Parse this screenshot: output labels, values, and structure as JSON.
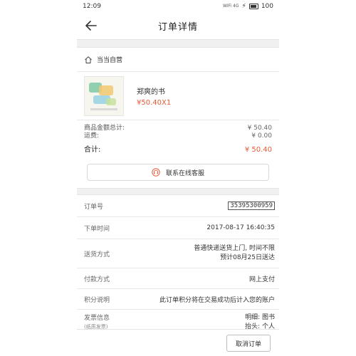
{
  "status": {
    "time": "12:09",
    "net": "WiFi 4G",
    "battery": "100"
  },
  "header": {
    "title": "订单详情"
  },
  "store": {
    "name": "当当自营"
  },
  "product": {
    "title": "郑爽的书",
    "price": "¥50.40X1"
  },
  "summary": {
    "goods_label": "商品金额总计:",
    "goods_value": "¥ 50.40",
    "shipping_label": "运费:",
    "shipping_value": "¥ 0.00",
    "total_label": "合计:",
    "total_value": "¥ 50.40"
  },
  "service": {
    "label": "联系在线客服"
  },
  "details": {
    "order_no_label": "订单号",
    "order_no": "35395300959",
    "order_time_label": "下单时间",
    "order_time": "2017-08-17 16:40:35",
    "delivery_label": "送货方式",
    "delivery_line1": "普通快递送货上门, 时间不限",
    "delivery_line2": "预计08月25日送达",
    "payment_label": "付款方式",
    "payment_value": "网上支付",
    "points_label": "积分说明",
    "points_value": "此订单积分将在交易成功后计入您的账户",
    "invoice_label": "发票信息",
    "invoice_sub": "(纸质发票)",
    "invoice_line1": "明细: 图书",
    "invoice_line2": "抬头: 个人"
  },
  "actions": {
    "cancel": "取消订单"
  },
  "colors": {
    "accent": "#e65a38"
  }
}
